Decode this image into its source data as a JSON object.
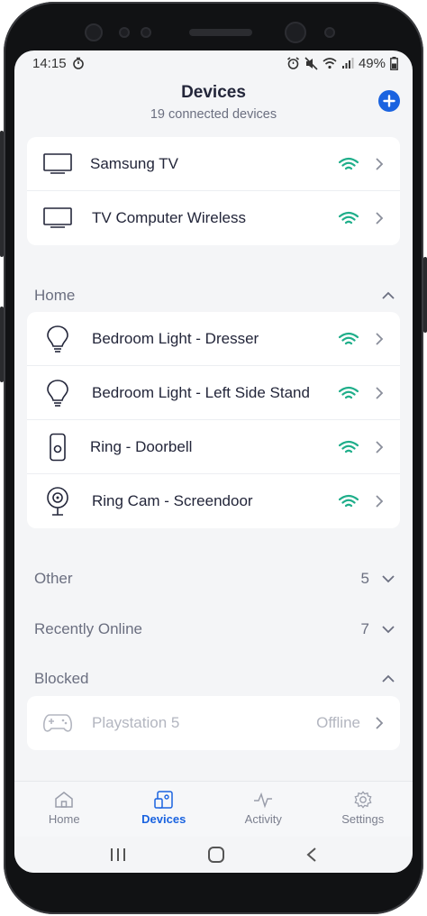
{
  "status_bar": {
    "time": "14:15",
    "battery": "49%"
  },
  "header": {
    "title": "Devices",
    "subtitle": "19 connected devices"
  },
  "top_devices": [
    {
      "label": "Samsung TV",
      "icon": "tv-icon"
    },
    {
      "label": "TV Computer Wireless",
      "icon": "tv-icon"
    }
  ],
  "sections": {
    "home": {
      "title": "Home"
    },
    "other": {
      "title": "Other",
      "count": "5"
    },
    "recently_online": {
      "title": "Recently Online",
      "count": "7"
    },
    "blocked": {
      "title": "Blocked"
    }
  },
  "home_devices": [
    {
      "label": "Bedroom Light - Dresser",
      "icon": "lightbulb-icon"
    },
    {
      "label": "Bedroom Light - Left Side Stand",
      "icon": "lightbulb-icon"
    },
    {
      "label": "Ring - Doorbell",
      "icon": "doorbell-icon"
    },
    {
      "label": "Ring Cam - Screendoor",
      "icon": "camera-icon"
    }
  ],
  "blocked_devices": [
    {
      "label": "Playstation 5",
      "status": "Offline",
      "icon": "gamepad-icon"
    }
  ],
  "bottom_nav": [
    {
      "label": "Home",
      "icon": "home-icon"
    },
    {
      "label": "Devices",
      "icon": "devices-icon",
      "active": true
    },
    {
      "label": "Activity",
      "icon": "activity-icon"
    },
    {
      "label": "Settings",
      "icon": "gear-icon"
    }
  ],
  "colors": {
    "accent": "#1a63e0",
    "wifi": "#1fae8a",
    "text": "#23263a"
  }
}
